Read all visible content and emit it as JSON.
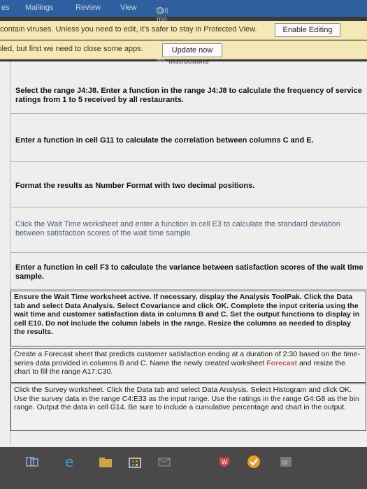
{
  "ribbon": {
    "tab_es": "es",
    "tab_mailings": "Mailings",
    "tab_review": "Review",
    "tab_view": "View",
    "tell_me": "Tell me what you want to do"
  },
  "protected_view": {
    "message": "contain viruses. Unless you need to edit, it's safer to stay in Protected View.",
    "button": "Enable Editing"
  },
  "update_bar": {
    "message": "iled, but first we need to close some apps.",
    "button": "Update now"
  },
  "sheet": {
    "heading": "Instructions",
    "rows": [
      "Select the range J4:J8. Enter a function in the range J4:J8 to calculate the frequency of service ratings from 1 to 5 received by all restaurants.",
      "Enter a function in cell G11 to calculate the correlation between columns C and E.",
      "Format the results as Number Format with two decimal positions.",
      "Click the Wait Time worksheet and enter a function in cell E3 to calculate the standard deviation between satisfaction scores of the wait time sample.",
      "Enter a function in cell F3 to calculate the variance between satisfaction scores of the wait time sample.",
      "Ensure the Wait Time worksheet active. If necessary, display the Analysis ToolPak. Click the Data tab and select Data Analysis. Select Covariance and click OK. Complete the input criteria using the wait time and customer satisfaction data in columns B and C. Set the output functions to display in cell E10. Do not include the column labels in the range. Resize the columns as needed to display the results."
    ],
    "row6_pre": "Create a Forecast sheet that predicts customer satisfaction ending at a duration of 2:30 based on the time-series data provided in columns B and C. Name the newly created worksheet ",
    "row6_keyword": "Forecast",
    "row6_post": " and resize the chart to fill the range A17:C30.",
    "row7": "Click the Survey worksheet. Click the Data tab and select Data Analysis. Select Histogram and click OK. Use the survey data in the range C4:E33 as the input range. Use the ratings in the range G4:G8 as the bin range. Output the data in cell G14. Be sure to include a cumulative percentage and chart in the output."
  },
  "taskbar": {
    "icons": [
      "task-view-icon",
      "edge-icon",
      "folder-icon",
      "store-icon",
      "mail-icon",
      "office-icon",
      "checkmark-icon",
      "word-icon"
    ]
  }
}
